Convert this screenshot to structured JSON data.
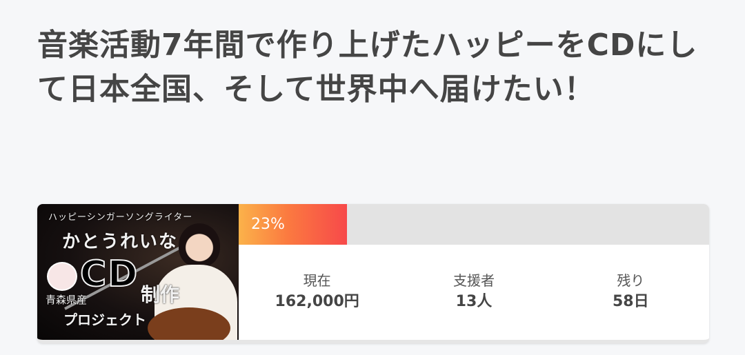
{
  "project": {
    "title": "音楽活動7年間で作り上げたハッピーをCDにして日本全国、そして世界中へ届けたい！"
  },
  "thumbnail": {
    "line1": "ハッピーシンガーソングライター",
    "line2": "かとうれいな",
    "line3": "CD",
    "line4": "制作",
    "line5": "青森県産",
    "line6": "プロジェクト"
  },
  "progress": {
    "percent_label": "23%",
    "fraction": 0.23,
    "fill_color": "#f7494a"
  },
  "stats": [
    {
      "label": "現在",
      "value": "162,000円"
    },
    {
      "label": "支援者",
      "value": "13人"
    },
    {
      "label": "残り",
      "value": "58日"
    }
  ]
}
